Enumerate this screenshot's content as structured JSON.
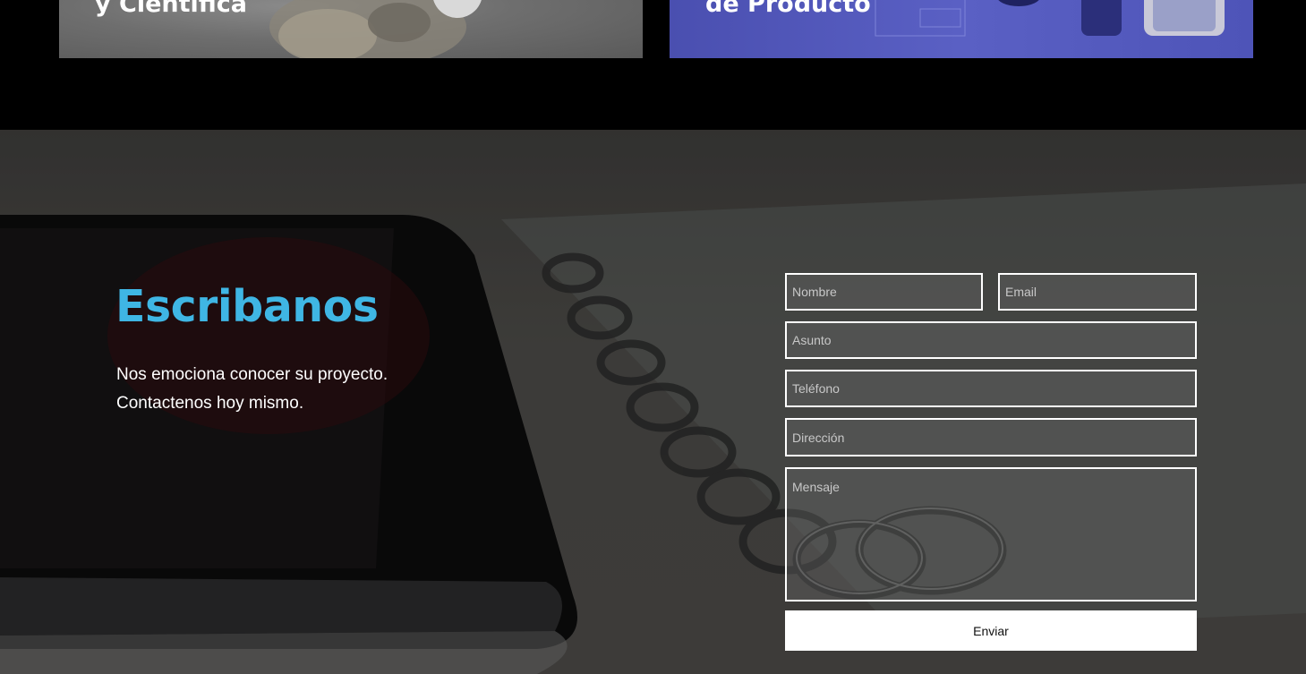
{
  "cards": [
    {
      "title": "y Científica"
    },
    {
      "title": "de Producto"
    }
  ],
  "contact": {
    "heading": "Escribanos",
    "lead_line1": "Nos emociona conocer su proyecto.",
    "lead_line2": "Contactenos hoy mismo."
  },
  "form": {
    "name_placeholder": "Nombre",
    "email_placeholder": "Email",
    "subject_placeholder": "Asunto",
    "phone_placeholder": "Teléfono",
    "address_placeholder": "Dirección",
    "message_placeholder": "Mensaje",
    "submit_label": "Enviar"
  },
  "colors": {
    "accent": "#3fb6e4",
    "page_background": "#000000",
    "card_right_blue": "#4e54b8"
  }
}
